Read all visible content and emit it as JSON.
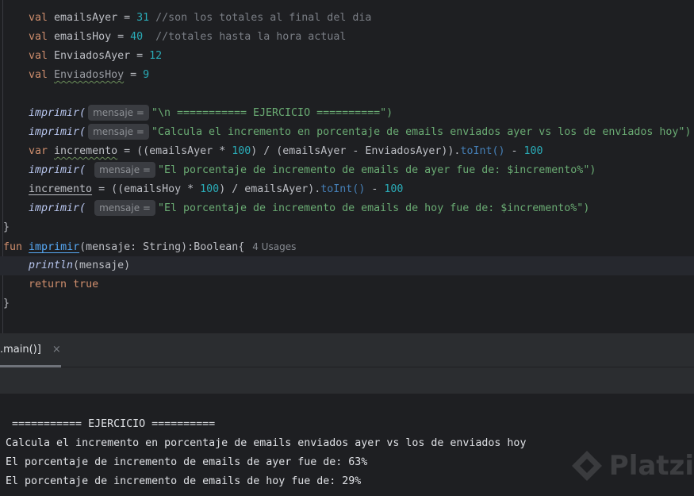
{
  "code": {
    "l1": {
      "kw": "val",
      "name": "emailsAyer",
      "eq": " = ",
      "num": "31",
      "comment": " //son los totales al final del dia"
    },
    "l2": {
      "kw": "val",
      "name": "emailsHoy",
      "eq": " = ",
      "num": "40",
      "comment": "  //totales hasta la hora actual"
    },
    "l3": {
      "kw": "val",
      "name": "EnviadosAyer",
      "eq": " = ",
      "num": "12"
    },
    "l4": {
      "kw": "val",
      "name": "EnviadosHoy",
      "eq": " = ",
      "num": "9"
    },
    "fn_call": "imprimir(",
    "hint": "mensaje =",
    "s1": "\"\\n =========== EJERCICIO ==========\")",
    "s2": "\"Calcula el incremento en porcentaje de emails enviados ayer vs los de enviados hoy\")",
    "l7": {
      "kw": "var",
      "name": "incremento",
      "a": " = ((emailsAyer * ",
      "num": "100",
      "b": ") / (emailsAyer - EnviadosAyer)).",
      "call": "toInt()",
      "c": " - ",
      "num2": "100"
    },
    "s3": "\"El porcentaje de incremento de emails de ayer fue de: $incremento%\")",
    "l9": {
      "name": "incremento",
      "a": " = ((emailsHoy * ",
      "num": "100",
      "b": ") / emailsAyer).",
      "call": "toInt()",
      "c": " - ",
      "num2": "100"
    },
    "s4": "\"El porcentaje de incremento de emails de hoy fue de: $incremento%\")",
    "close": "}",
    "fun": {
      "kw": "fun",
      "name": "imprimir",
      "sig": "(mensaje: String):Boolean{",
      "usages": "4 Usages"
    },
    "println": "println",
    "println_arg": "(mensaje)",
    "ret": {
      "kw": "return",
      "val": "true"
    }
  },
  "run_tab": {
    "label": ".main()]",
    "close": "×"
  },
  "console": [
    " =========== EJERCICIO ==========",
    "Calcula el incremento en porcentaje de emails enviados ayer vs los de enviados hoy",
    "El porcentaje de incremento de emails de ayer fue de: 63%",
    "El porcentaje de incremento de emails de hoy fue de: 29%"
  ],
  "watermark": "Platzi"
}
